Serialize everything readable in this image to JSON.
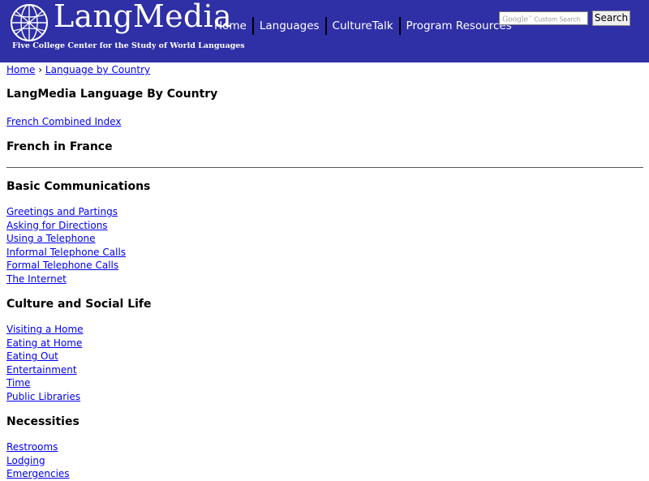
{
  "header": {
    "logo_title": "LangMedia",
    "logo_tagline": "Five College Center for the Study of World Languages",
    "nav": [
      {
        "label": "Home"
      },
      {
        "label": "Languages"
      },
      {
        "label": "CultureTalk"
      },
      {
        "label": "Program Resources"
      }
    ],
    "search": {
      "brand": "Google",
      "placeholder": "Custom Search",
      "button_label": "Search"
    },
    "colors": {
      "background": "#2f2fa6",
      "text": "#ffffff"
    }
  },
  "breadcrumb": {
    "home": "Home",
    "separator": "›",
    "current": "Language by Country"
  },
  "page_title": "LangMedia Language By Country",
  "combined_index_link": "French Combined Index",
  "subtitle": "French in France",
  "sections": [
    {
      "heading": "Basic Communications",
      "links": [
        "Greetings and Partings",
        "Asking for Directions",
        "Using a Telephone",
        "Informal Telephone Calls",
        "Formal Telephone Calls",
        "The Internet"
      ]
    },
    {
      "heading": "Culture and Social Life",
      "links": [
        "Visiting a Home",
        "Eating at Home",
        "Eating Out",
        "Entertainment",
        "Time",
        "Public Libraries"
      ]
    },
    {
      "heading": "Necessities",
      "links": [
        "Restrooms",
        "Lodging",
        "Emergencies"
      ]
    }
  ]
}
